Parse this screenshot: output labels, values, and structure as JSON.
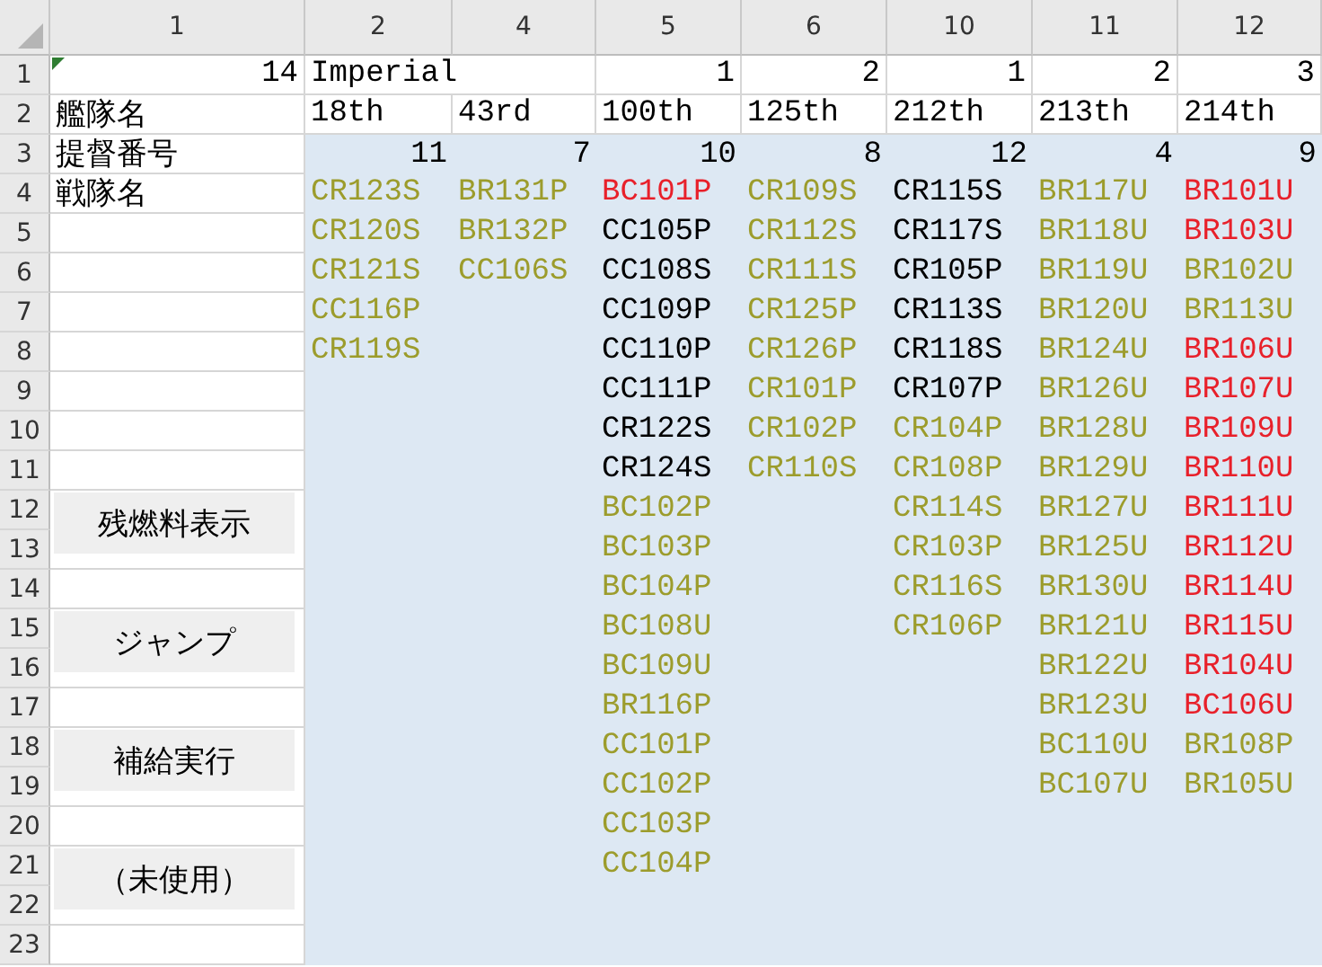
{
  "column_headers": [
    "1",
    "2",
    "4",
    "5",
    "6",
    "10",
    "11",
    "12"
  ],
  "row_numbers": [
    "1",
    "2",
    "3",
    "4",
    "5",
    "6",
    "7",
    "8",
    "9",
    "10",
    "11",
    "12",
    "13",
    "14",
    "15",
    "16",
    "17",
    "18",
    "19",
    "20",
    "21",
    "22",
    "23"
  ],
  "corner_value": "14",
  "title": "Imperial",
  "labels": [
    "艦隊名",
    "提督番号",
    "戦隊名"
  ],
  "fleets": [
    {
      "name": "18th",
      "admiral": "11",
      "units": [
        {
          "code": "CR123S",
          "color": "#9c9c2c"
        },
        {
          "code": "CR120S",
          "color": "#9c9c2c"
        },
        {
          "code": "CR121S",
          "color": "#9c9c2c"
        },
        {
          "code": "CC116P",
          "color": "#9c9c2c"
        },
        {
          "code": "CR119S",
          "color": "#9c9c2c"
        }
      ]
    },
    {
      "name": "43rd",
      "admiral": "7",
      "units": [
        {
          "code": "BR131P",
          "color": "#9c9c2c"
        },
        {
          "code": "BR132P",
          "color": "#9c9c2c"
        },
        {
          "code": "CC106S",
          "color": "#9c9c2c"
        }
      ]
    },
    {
      "number": "1",
      "name": "100th",
      "admiral": "10",
      "units": [
        {
          "code": "BC101P",
          "color": "#e8202a"
        },
        {
          "code": "CC105P",
          "color": "#000000"
        },
        {
          "code": "CC108S",
          "color": "#000000"
        },
        {
          "code": "CC109P",
          "color": "#000000"
        },
        {
          "code": "CC110P",
          "color": "#000000"
        },
        {
          "code": "CC111P",
          "color": "#000000"
        },
        {
          "code": "CR122S",
          "color": "#000000"
        },
        {
          "code": "CR124S",
          "color": "#000000"
        },
        {
          "code": "BC102P",
          "color": "#9c9c2c"
        },
        {
          "code": "BC103P",
          "color": "#9c9c2c"
        },
        {
          "code": "BC104P",
          "color": "#9c9c2c"
        },
        {
          "code": "BC108U",
          "color": "#9c9c2c"
        },
        {
          "code": "BC109U",
          "color": "#9c9c2c"
        },
        {
          "code": "BR116P",
          "color": "#9c9c2c"
        },
        {
          "code": "CC101P",
          "color": "#9c9c2c"
        },
        {
          "code": "CC102P",
          "color": "#9c9c2c"
        },
        {
          "code": "CC103P",
          "color": "#9c9c2c"
        },
        {
          "code": "CC104P",
          "color": "#9c9c2c"
        }
      ]
    },
    {
      "number": "2",
      "name": "125th",
      "admiral": "8",
      "units": [
        {
          "code": "CR109S",
          "color": "#9c9c2c"
        },
        {
          "code": "CR112S",
          "color": "#9c9c2c"
        },
        {
          "code": "CR111S",
          "color": "#9c9c2c"
        },
        {
          "code": "CR125P",
          "color": "#9c9c2c"
        },
        {
          "code": "CR126P",
          "color": "#9c9c2c"
        },
        {
          "code": "CR101P",
          "color": "#9c9c2c"
        },
        {
          "code": "CR102P",
          "color": "#9c9c2c"
        },
        {
          "code": "CR110S",
          "color": "#9c9c2c"
        }
      ]
    },
    {
      "number": "1",
      "name": "212th",
      "admiral": "12",
      "units": [
        {
          "code": "CR115S",
          "color": "#000000"
        },
        {
          "code": "CR117S",
          "color": "#000000"
        },
        {
          "code": "CR105P",
          "color": "#000000"
        },
        {
          "code": "CR113S",
          "color": "#000000"
        },
        {
          "code": "CR118S",
          "color": "#000000"
        },
        {
          "code": "CR107P",
          "color": "#000000"
        },
        {
          "code": "CR104P",
          "color": "#9c9c2c"
        },
        {
          "code": "CR108P",
          "color": "#9c9c2c"
        },
        {
          "code": "CR114S",
          "color": "#9c9c2c"
        },
        {
          "code": "CR103P",
          "color": "#9c9c2c"
        },
        {
          "code": "CR116S",
          "color": "#9c9c2c"
        },
        {
          "code": "CR106P",
          "color": "#9c9c2c"
        }
      ]
    },
    {
      "number": "2",
      "name": "213th",
      "admiral": "4",
      "units": [
        {
          "code": "BR117U",
          "color": "#9c9c2c"
        },
        {
          "code": "BR118U",
          "color": "#9c9c2c"
        },
        {
          "code": "BR119U",
          "color": "#9c9c2c"
        },
        {
          "code": "BR120U",
          "color": "#9c9c2c"
        },
        {
          "code": "BR124U",
          "color": "#9c9c2c"
        },
        {
          "code": "BR126U",
          "color": "#9c9c2c"
        },
        {
          "code": "BR128U",
          "color": "#9c9c2c"
        },
        {
          "code": "BR129U",
          "color": "#9c9c2c"
        },
        {
          "code": "BR127U",
          "color": "#9c9c2c"
        },
        {
          "code": "BR125U",
          "color": "#9c9c2c"
        },
        {
          "code": "BR130U",
          "color": "#9c9c2c"
        },
        {
          "code": "BR121U",
          "color": "#9c9c2c"
        },
        {
          "code": "BR122U",
          "color": "#9c9c2c"
        },
        {
          "code": "BR123U",
          "color": "#9c9c2c"
        },
        {
          "code": "BC110U",
          "color": "#9c9c2c"
        },
        {
          "code": "BC107U",
          "color": "#9c9c2c"
        }
      ]
    },
    {
      "number": "3",
      "name": "214th",
      "admiral": "9",
      "units": [
        {
          "code": "BR101U",
          "color": "#e8202a"
        },
        {
          "code": "BR103U",
          "color": "#e8202a"
        },
        {
          "code": "BR102U",
          "color": "#9c9c2c"
        },
        {
          "code": "BR113U",
          "color": "#9c9c2c"
        },
        {
          "code": "BR106U",
          "color": "#e8202a"
        },
        {
          "code": "BR107U",
          "color": "#e8202a"
        },
        {
          "code": "BR109U",
          "color": "#e8202a"
        },
        {
          "code": "BR110U",
          "color": "#e8202a"
        },
        {
          "code": "BR111U",
          "color": "#e8202a"
        },
        {
          "code": "BR112U",
          "color": "#e8202a"
        },
        {
          "code": "BR114U",
          "color": "#e8202a"
        },
        {
          "code": "BR115U",
          "color": "#e8202a"
        },
        {
          "code": "BR104U",
          "color": "#e8202a"
        },
        {
          "code": "BC106U",
          "color": "#e8202a"
        },
        {
          "code": "BR108P",
          "color": "#9c9c2c"
        },
        {
          "code": "BR105U",
          "color": "#9c9c2c"
        }
      ]
    }
  ],
  "buttons": [
    "残燃料表示",
    "ジャンプ",
    "補給実行",
    "（未使用）"
  ]
}
